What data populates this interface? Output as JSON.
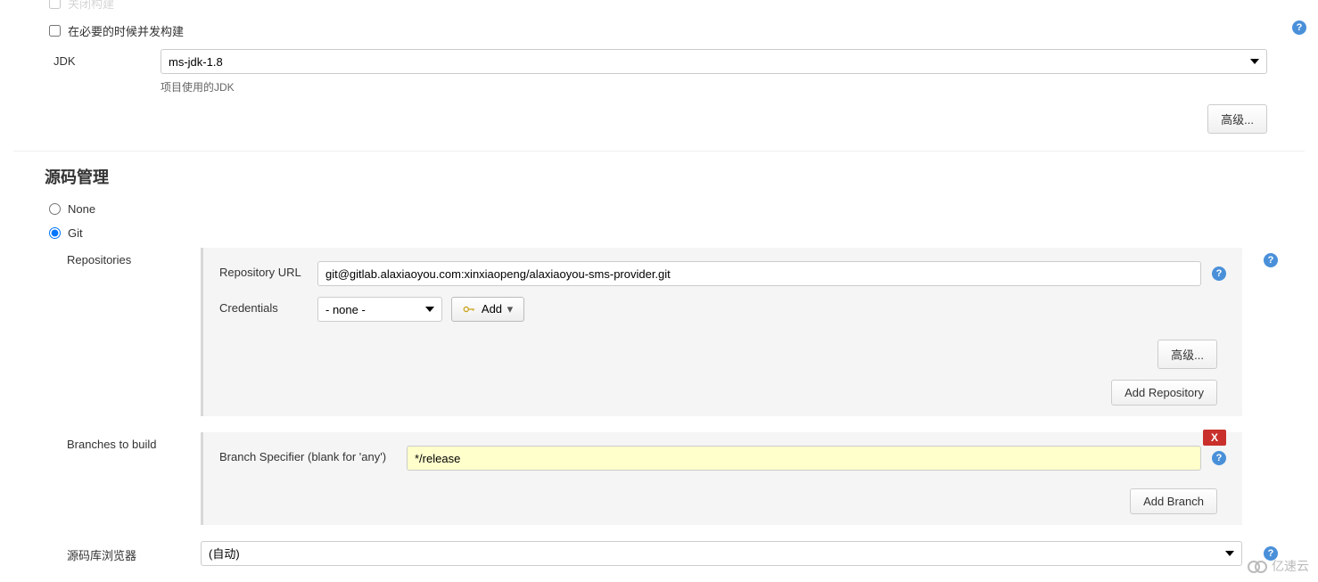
{
  "top": {
    "checkbox_partial_label": "关闭构建",
    "concurrent_label": "在必要的时候并发构建",
    "jdk_label": "JDK",
    "jdk_value": "ms-jdk-1.8",
    "jdk_help": "项目使用的JDK",
    "advanced": "高级..."
  },
  "scm": {
    "header": "源码管理",
    "none": "None",
    "git": "Git",
    "repositories_label": "Repositories",
    "repo_url_label": "Repository URL",
    "repo_url_value": "git@gitlab.alaxiaoyou.com:xinxiaopeng/alaxiaoyou-sms-provider.git",
    "credentials_label": "Credentials",
    "credentials_value": "- none -",
    "add_cred": "Add",
    "advanced": "高级...",
    "add_repo": "Add Repository",
    "branches_label": "Branches to build",
    "branch_spec_label": "Branch Specifier (blank for 'any')",
    "branch_spec_value": "*/release",
    "delete": "X",
    "add_branch": "Add Branch",
    "repo_browser_label": "源码库浏览器",
    "repo_browser_value": "(自动)"
  },
  "watermark": "亿速云"
}
